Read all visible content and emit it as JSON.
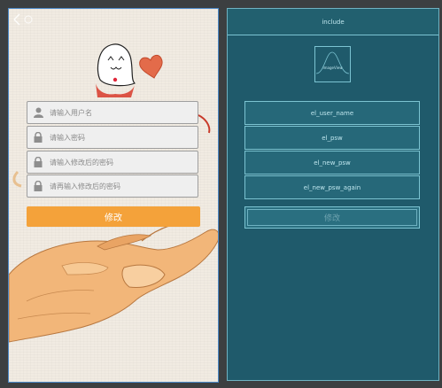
{
  "preview": {
    "username_placeholder": "请输入用户名",
    "password_placeholder": "请输入密码",
    "new_password_placeholder": "请输入修改后的密码",
    "new_password_again_placeholder": "请再输入修改后的密码",
    "submit_label": "修改"
  },
  "blueprint": {
    "include_label": "include",
    "imageview_label": "ImageView",
    "fields": [
      "el_user_name",
      "el_psw",
      "el_new_psw",
      "el_new_psw_again"
    ],
    "button_label": "修改"
  },
  "colors": {
    "accent_orange": "#f4a23a",
    "blueprint_bg": "#1f5a6b",
    "selection_border": "#4a88c7"
  }
}
